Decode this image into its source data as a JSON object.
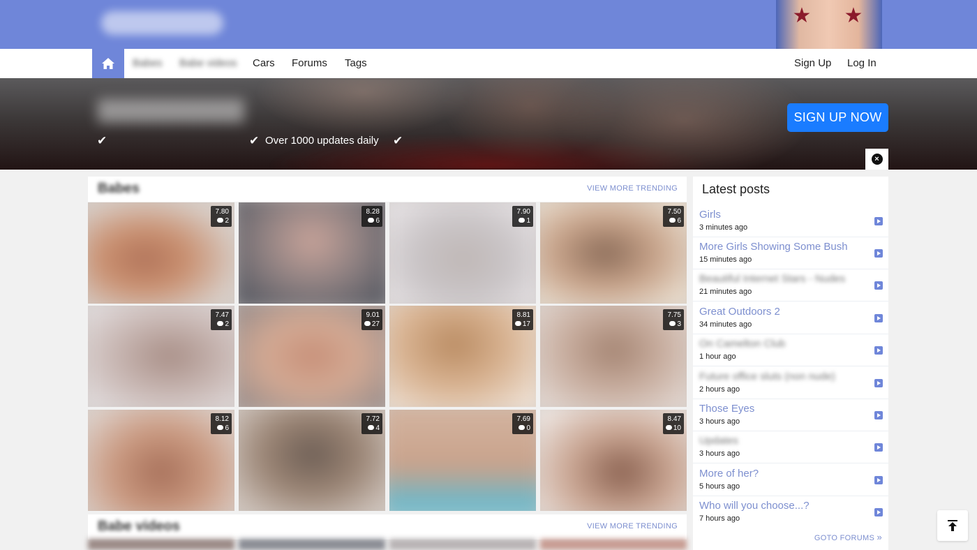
{
  "nav": {
    "items": [
      {
        "label": "Babes"
      },
      {
        "label": "Babe videos"
      },
      {
        "label": "Cars"
      },
      {
        "label": "Forums"
      },
      {
        "label": "Tags"
      }
    ],
    "sign_up": "Sign Up",
    "log_in": "Log In"
  },
  "promo": {
    "feature_2": "Over 1000 updates daily",
    "cta": "SIGN UP NOW"
  },
  "sections": [
    {
      "title": "Babes",
      "view_more": "VIEW MORE TRENDING"
    },
    {
      "title": "Babe videos",
      "view_more": "VIEW MORE TRENDING"
    }
  ],
  "thumbs": [
    {
      "rating": "7.80",
      "comments": "2"
    },
    {
      "rating": "8.28",
      "comments": "6"
    },
    {
      "rating": "7.90",
      "comments": "1"
    },
    {
      "rating": "7.50",
      "comments": "6"
    },
    {
      "rating": "7.47",
      "comments": "2"
    },
    {
      "rating": "9.01",
      "comments": "27"
    },
    {
      "rating": "8.81",
      "comments": "17"
    },
    {
      "rating": "7.75",
      "comments": "3"
    },
    {
      "rating": "8.12",
      "comments": "6"
    },
    {
      "rating": "7.72",
      "comments": "4"
    },
    {
      "rating": "7.69",
      "comments": "0"
    },
    {
      "rating": "8.47",
      "comments": "10"
    }
  ],
  "sidebar": {
    "title": "Latest posts",
    "posts": [
      {
        "title": "Girls",
        "time": "3 minutes ago"
      },
      {
        "title": "More Girls Showing Some Bush",
        "time": "15 minutes ago"
      },
      {
        "title": "Beautiful Internet Stars - Nudes",
        "time": "21 minutes ago"
      },
      {
        "title": "Great Outdoors 2",
        "time": "34 minutes ago"
      },
      {
        "title": "On Camelton Club",
        "time": "1 hour ago"
      },
      {
        "title": "Future office sluts (non nude)",
        "time": "2 hours ago"
      },
      {
        "title": "Those Eyes",
        "time": "3 hours ago"
      },
      {
        "title": "Updates",
        "time": "3 hours ago"
      },
      {
        "title": "More of her?",
        "time": "5 hours ago"
      },
      {
        "title": "Who will you choose...?",
        "time": "7 hours ago"
      }
    ],
    "goto": "GOTO FORUMS"
  },
  "colors": {
    "brand": "#6f86d9",
    "cta": "#1a7cff",
    "link": "#7d8fcf"
  }
}
